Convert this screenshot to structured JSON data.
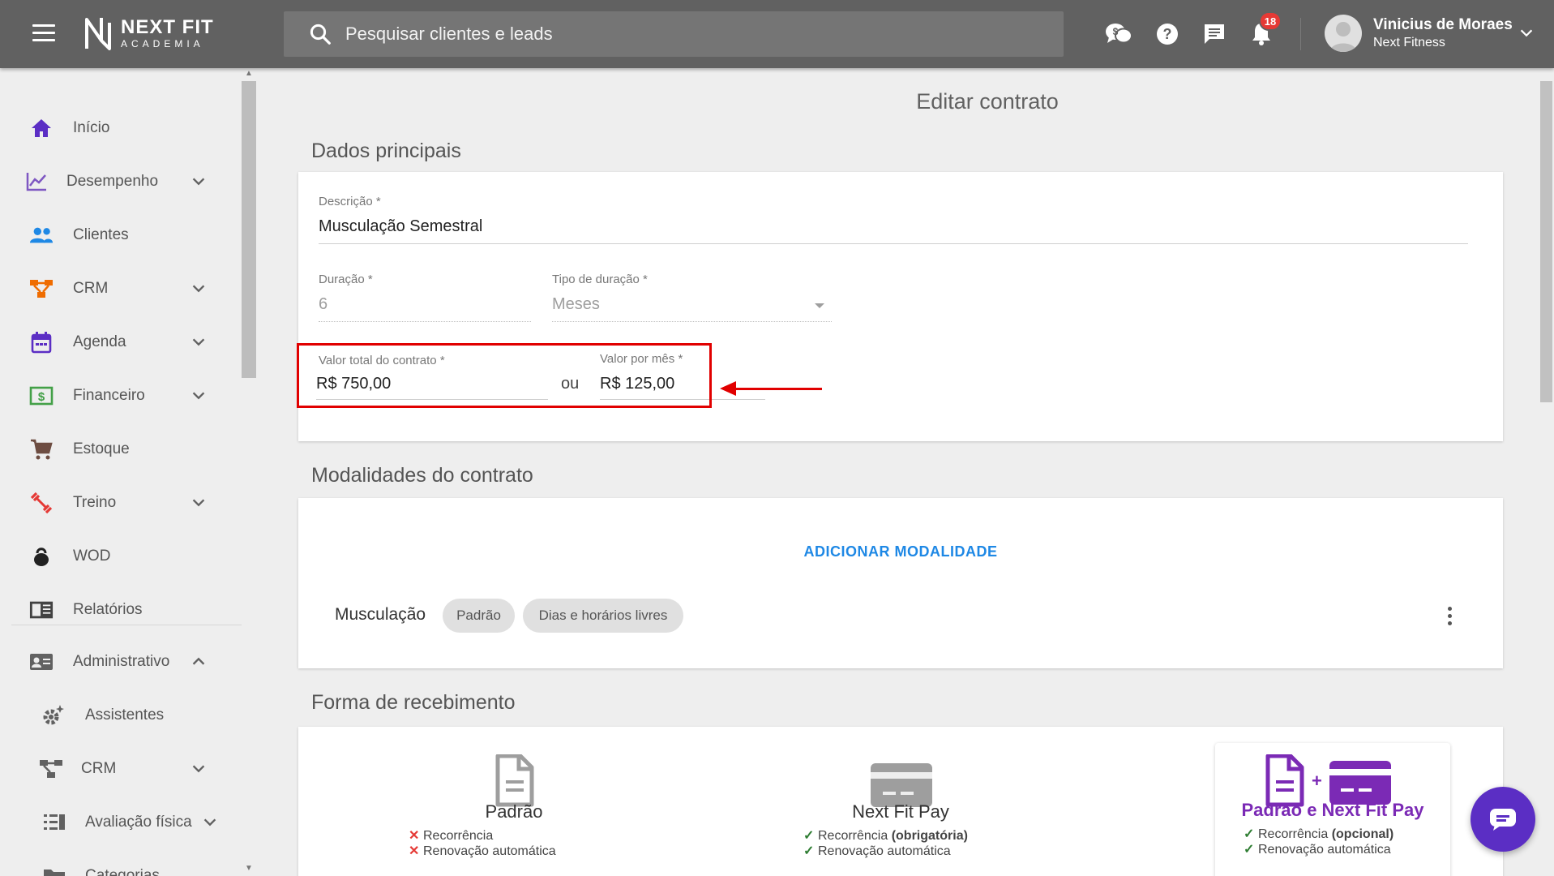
{
  "app": {
    "logo_line1": "NEXT FIT",
    "logo_line2": "ACADEMIA"
  },
  "search": {
    "placeholder": "Pesquisar clientes e leads"
  },
  "topbar": {
    "notification_count": "18",
    "user_name": "Vinicius de Moraes",
    "user_company": "Next Fitness"
  },
  "sidebar": {
    "items": [
      {
        "label": "Início",
        "icon": "home-icon",
        "color": "#5b2ec4"
      },
      {
        "label": "Desempenho",
        "icon": "chart-line-icon",
        "color": "#7e57c2"
      },
      {
        "label": "Clientes",
        "icon": "people-icon",
        "color": "#1e88e5"
      },
      {
        "label": "CRM",
        "icon": "crm-icon",
        "color": "#ef6c00"
      },
      {
        "label": "Agenda",
        "icon": "calendar-icon",
        "color": "#5b2ec4"
      },
      {
        "label": "Financeiro",
        "icon": "money-icon",
        "color": "#43a047"
      },
      {
        "label": "Estoque",
        "icon": "cart-icon",
        "color": "#6d4c41"
      },
      {
        "label": "Treino",
        "icon": "dumbbell-icon",
        "color": "#e53935"
      },
      {
        "label": "WOD",
        "icon": "kettlebell-icon",
        "color": "#212121"
      },
      {
        "label": "Relatórios",
        "icon": "report-icon",
        "color": "#424242"
      },
      {
        "label": "Administrativo",
        "icon": "id-card-icon",
        "color": "#616161"
      },
      {
        "label": "Assistentes",
        "icon": "gear-sparkle-icon",
        "color": "#616161"
      },
      {
        "label": "CRM",
        "icon": "crm-icon",
        "color": "#616161"
      },
      {
        "label": "Avaliação física",
        "icon": "list-icon",
        "color": "#616161"
      },
      {
        "label": "Categorias",
        "icon": "folder-icon",
        "color": "#616161"
      }
    ]
  },
  "page": {
    "title": "Editar contrato"
  },
  "main_section": {
    "title": "Dados principais",
    "descricao_label": "Descrição",
    "descricao_value": "Musculação Semestral",
    "duracao_label": "Duração",
    "duracao_value": "6",
    "tipo_label": "Tipo de duração",
    "tipo_value": "Meses",
    "valor_total_label": "Valor total do contrato",
    "valor_total_value": "R$ 750,00",
    "ou": "ou",
    "valor_mes_label": "Valor por mês",
    "valor_mes_value": "R$ 125,00",
    "required_mark": "*"
  },
  "modalidades": {
    "title": "Modalidades do contrato",
    "add_label": "ADICIONAR MODALIDADE",
    "item_name": "Musculação",
    "chips": [
      "Padrão",
      "Dias e horários livres"
    ]
  },
  "recebimento": {
    "title": "Forma de recebimento",
    "options": [
      {
        "title": "Padrão",
        "features": [
          {
            "mark": "✕",
            "text": "Recorrência",
            "bold": ""
          },
          {
            "mark": "✕",
            "text": "Renovação automática",
            "bold": ""
          }
        ]
      },
      {
        "title": "Next Fit Pay",
        "features": [
          {
            "mark": "✓",
            "text": "Recorrência ",
            "bold": "(obrigatória)"
          },
          {
            "mark": "✓",
            "text": "Renovação automática",
            "bold": ""
          }
        ]
      },
      {
        "title": "Padrão e Next Fit Pay",
        "color": "#7b2ab5",
        "features": [
          {
            "mark": "✓",
            "text": "Recorrência ",
            "bold": "(opcional)"
          },
          {
            "mark": "✓",
            "text": "Renovação automática",
            "bold": ""
          }
        ]
      }
    ]
  }
}
